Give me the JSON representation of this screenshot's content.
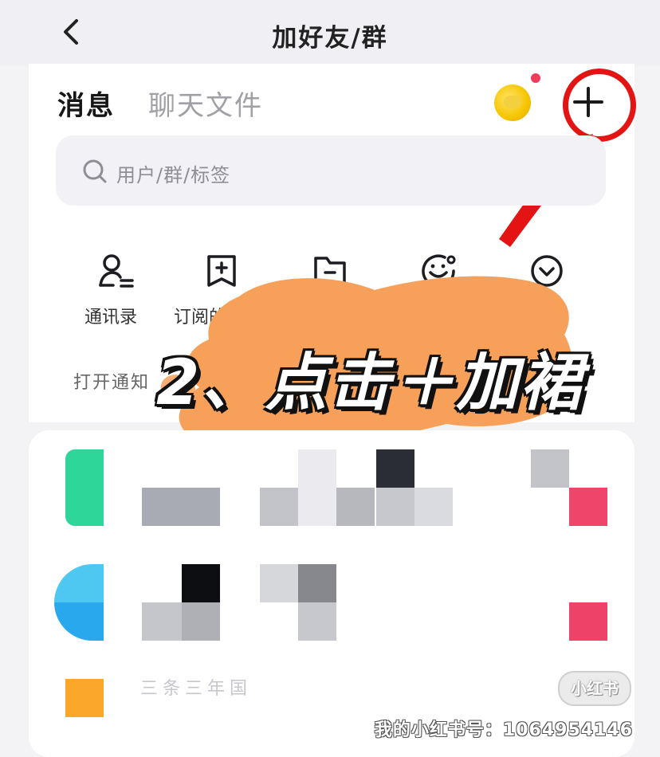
{
  "header": {
    "title": "加好友/群"
  },
  "tabs": [
    {
      "label": "消息",
      "active": true
    },
    {
      "label": "聊天文件",
      "active": false
    }
  ],
  "search": {
    "placeholder": "用户/群/标签"
  },
  "quick_actions": [
    {
      "label": "通讯录",
      "icon": "contacts-icon"
    },
    {
      "label": "订阅的",
      "icon": "bookmark-icon"
    },
    {
      "label": "",
      "icon": "folder-icon"
    },
    {
      "label": "",
      "icon": "smiley-icon"
    },
    {
      "label": "",
      "icon": "chevron-down-circle-icon"
    }
  ],
  "notice": {
    "text": "打开通知"
  },
  "overlay": {
    "text": "2、点击＋加裙"
  },
  "list": {
    "faint_text": "三条三年国"
  },
  "watermark": {
    "badge": "小红书",
    "text": "我的小红书号：1064954146"
  },
  "colors": {
    "accent_red": "#e41414",
    "reddot": "#f03c5c",
    "splash": "#f6a05a",
    "coin": "#f5c400"
  }
}
